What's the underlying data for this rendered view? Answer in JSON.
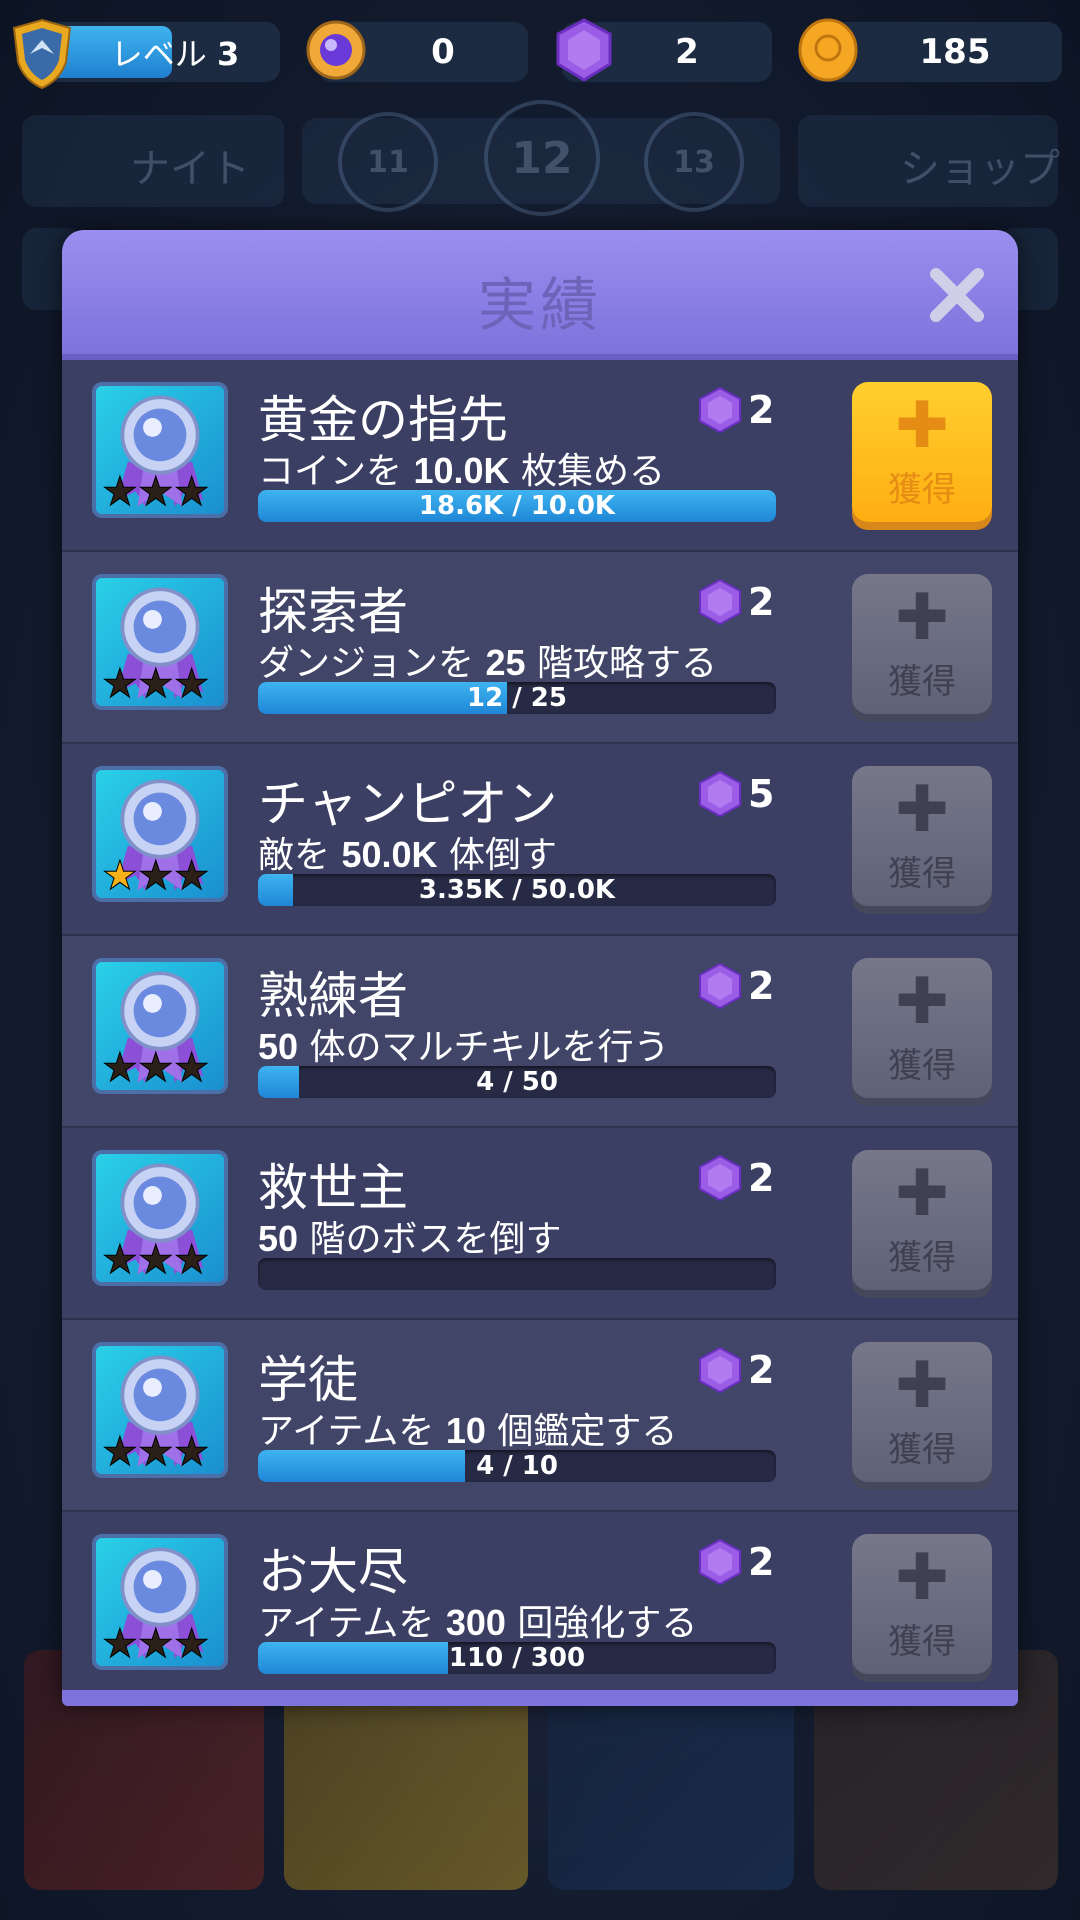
{
  "topbar": {
    "level_label": "レベル",
    "level_value": "3",
    "level_progress": 0.55,
    "orbs": "0",
    "gems": "2",
    "coins": "185"
  },
  "background": {
    "knight_label": "ナイト",
    "shop_label": "ショップ",
    "floors": [
      "11",
      "12",
      "13"
    ]
  },
  "modal": {
    "title": "実績",
    "claim_label": "獲得",
    "achievements": [
      {
        "name": "黄金の指先",
        "desc_pre": "コインを ",
        "desc_num": "10.0K",
        "desc_post": " 枚集める",
        "reward": "2",
        "progress_text": "18.6K / 10.0K",
        "progress": 1.0,
        "stars": 0,
        "claimable": true
      },
      {
        "name": "探索者",
        "desc_pre": "ダンジョンを ",
        "desc_num": "25",
        "desc_post": " 階攻略する",
        "reward": "2",
        "progress_text": "12 / 25",
        "progress": 0.48,
        "stars": 0,
        "claimable": false
      },
      {
        "name": "チャンピオン",
        "desc_pre": "敵を ",
        "desc_num": "50.0K",
        "desc_post": " 体倒す",
        "reward": "5",
        "progress_text": "3.35K / 50.0K",
        "progress": 0.067,
        "stars": 1,
        "claimable": false
      },
      {
        "name": "熟練者",
        "desc_pre": "",
        "desc_num": "50",
        "desc_post": " 体のマルチキルを行う",
        "reward": "2",
        "progress_text": "4 / 50",
        "progress": 0.08,
        "stars": 0,
        "claimable": false
      },
      {
        "name": "救世主",
        "desc_pre": "",
        "desc_num": "50",
        "desc_post": " 階のボスを倒す",
        "reward": "2",
        "progress_text": "",
        "progress": 0.0,
        "stars": 0,
        "claimable": false
      },
      {
        "name": "学徒",
        "desc_pre": "アイテムを ",
        "desc_num": "10",
        "desc_post": " 個鑑定する",
        "reward": "2",
        "progress_text": "4 / 10",
        "progress": 0.4,
        "stars": 0,
        "claimable": false
      },
      {
        "name": "お大尽",
        "desc_pre": "アイテムを ",
        "desc_num": "300",
        "desc_post": " 回強化する",
        "reward": "2",
        "progress_text": "110 / 300",
        "progress": 0.3667,
        "stars": 0,
        "claimable": false
      }
    ]
  },
  "colors": {
    "accent_blue": "#3fb4f0",
    "gem_purple": "#9b5de5",
    "claim_gold": "#ffbf1f",
    "header_purple": "#8c80e6"
  }
}
